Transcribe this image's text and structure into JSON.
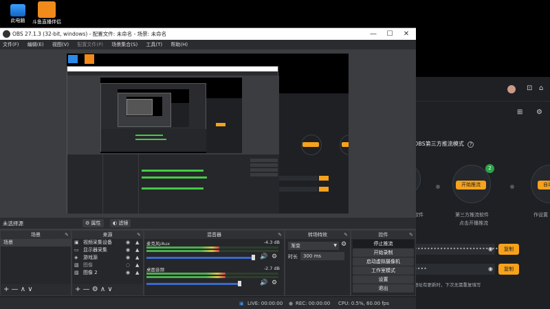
{
  "desktop": {
    "icons": [
      {
        "label": "此电脑"
      },
      {
        "label": "斗鱼直播伴侣"
      }
    ]
  },
  "bg_app": {
    "mode_title": "OBS第三方推流模式",
    "help_icon": "?",
    "step_badge": "2",
    "start_button": "开始推流",
    "auto_button": "自动",
    "step2_text1": "第三方推流软件",
    "step2_text2": "点击开播推流",
    "left_text": "软件",
    "right_text": "作设置",
    "field1_mask": "••••••••••••••••••••••••••",
    "field2_mask": "••••",
    "copy_button": "复制",
    "note": "地址有更新时，下次无需重复填写"
  },
  "obs": {
    "title": "OBS 27.1.3 (32-bit, windows) - 配置文件: 未命名 - 场景: 未命名",
    "window_controls": {
      "minimize": "—",
      "maximize": "☐",
      "close": "✕"
    },
    "menu": [
      "文件(F)",
      "编辑(E)",
      "视图(V)",
      "配置文件(P)",
      "场景集合(S)",
      "工具(T)",
      "帮助(H)"
    ],
    "context_bar": {
      "no_source": "未选择源",
      "properties": "属性",
      "filters": "滤镜"
    },
    "scenes_dock": {
      "title": "场景",
      "items": [
        "场景"
      ]
    },
    "sources_dock": {
      "title": "来源",
      "items": [
        "视频采集设备",
        "显示器采集",
        "游戏源",
        "图像",
        "图像 2"
      ]
    },
    "mixer_dock": {
      "title": "混音器",
      "tracks": [
        {
          "name": "麦克风/Aux",
          "db": "-4.3 dB",
          "level": 0.55
        },
        {
          "name": "桌面音频",
          "db": "-2.7 dB",
          "level": 0.6
        }
      ]
    },
    "transition_dock": {
      "title": "转场特效",
      "type": "渐变",
      "duration_label": "时长",
      "duration_value": "300 ms"
    },
    "controls_dock": {
      "title": "控件",
      "buttons": [
        "停止推流",
        "开始录制",
        "启动虚拟摄像机",
        "工作室模式",
        "设置",
        "退出"
      ]
    },
    "status": {
      "live": "LIVE: 00:00:00",
      "rec": "REC: 00:00:00",
      "cpu": "CPU: 0.5%, 60.00 fps"
    },
    "footer_glyphs": "+ — ∧ ∨"
  }
}
